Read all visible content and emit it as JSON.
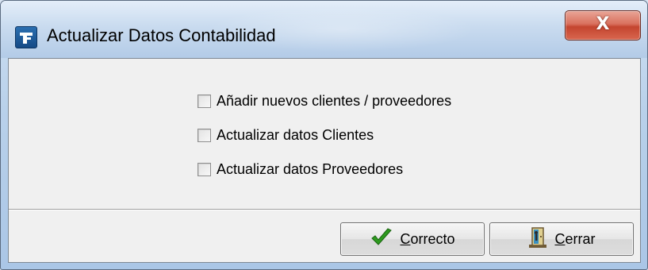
{
  "window": {
    "title": "Actualizar Datos Contabilidad",
    "app_icon": "app-logo-icon",
    "close_glyph": "X"
  },
  "options": [
    {
      "label": "Añadir nuevos clientes / proveedores",
      "checked": false
    },
    {
      "label": "Actualizar datos Clientes",
      "checked": false
    },
    {
      "label": "Actualizar datos Proveedores",
      "checked": false
    }
  ],
  "buttons": {
    "ok": {
      "label": "Correcto",
      "icon": "checkmark-icon",
      "color": "#2e9b1f"
    },
    "close": {
      "label": "Cerrar",
      "icon": "exit-door-icon"
    }
  }
}
